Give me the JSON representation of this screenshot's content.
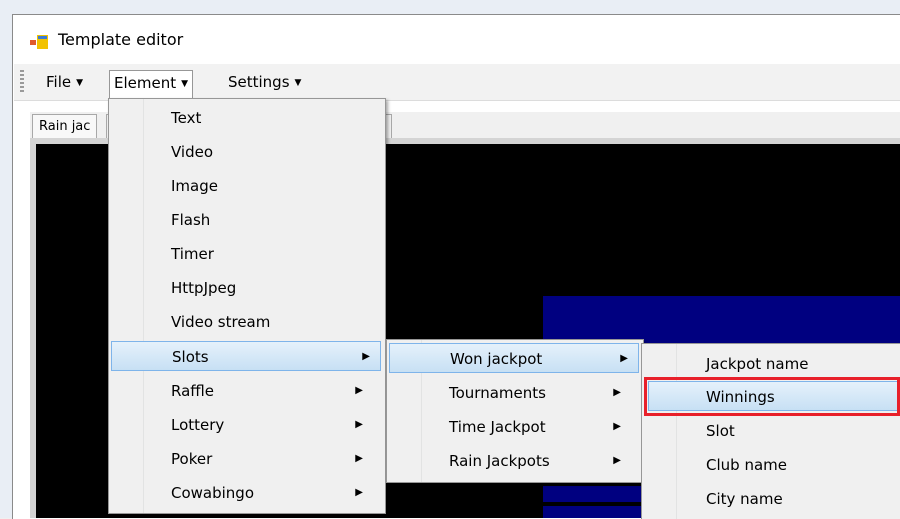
{
  "window": {
    "title": "Template editor",
    "icon": "app-window-icon"
  },
  "menubar": {
    "items": [
      {
        "label": "File"
      },
      {
        "label": "Element"
      },
      {
        "label": "Settings"
      }
    ]
  },
  "tabs": [
    {
      "label": "Rain jac"
    }
  ],
  "element_menu": {
    "items": [
      {
        "label": "Text"
      },
      {
        "label": "Video"
      },
      {
        "label": "Image"
      },
      {
        "label": "Flash"
      },
      {
        "label": "Timer"
      },
      {
        "label": "HttpJpeg"
      },
      {
        "label": "Video stream"
      },
      {
        "label": "Slots"
      },
      {
        "label": "Raffle"
      },
      {
        "label": "Lottery"
      },
      {
        "label": "Poker"
      },
      {
        "label": "Cowabingo"
      }
    ],
    "highlighted": "Slots"
  },
  "slots_menu": {
    "items": [
      {
        "label": "Won jackpot"
      },
      {
        "label": "Tournaments"
      },
      {
        "label": "Time Jackpot"
      },
      {
        "label": "Rain Jackpots"
      }
    ],
    "highlighted": "Won jackpot"
  },
  "won_jackpot_menu": {
    "items": [
      {
        "label": "Jackpot name"
      },
      {
        "label": "Winnings"
      },
      {
        "label": "Slot"
      },
      {
        "label": "Club name"
      },
      {
        "label": "City name"
      }
    ],
    "highlighted": "Winnings"
  },
  "colors": {
    "highlight_border": "#7eb4ea",
    "annotation_red": "#e8202a",
    "canvas_bg": "#000000",
    "canvas_block": "#000080"
  }
}
